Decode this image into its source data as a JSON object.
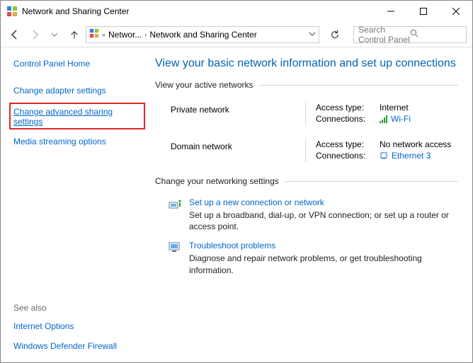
{
  "window": {
    "title": "Network and Sharing Center"
  },
  "breadcrumb": {
    "seg1": "Networ...",
    "seg2": "Network and Sharing Center"
  },
  "search": {
    "placeholder": "Search Control Panel"
  },
  "sidebar": {
    "home": "Control Panel Home",
    "adapter": "Change adapter settings",
    "adv_sharing": "Change advanced sharing settings",
    "media": "Media streaming options",
    "see_also": "See also",
    "internet_opts": "Internet Options",
    "firewall": "Windows Defender Firewall"
  },
  "main": {
    "heading": "View your basic network information and set up connections",
    "active_label": "View your active networks",
    "net1": {
      "name": "Private network",
      "access_label": "Access type:",
      "access_value": "Internet",
      "conn_label": "Connections:",
      "conn_value": "Wi-Fi"
    },
    "net2": {
      "name": "Domain network",
      "access_label": "Access type:",
      "access_value": "No network access",
      "conn_label": "Connections:",
      "conn_value": "Ethernet 3"
    },
    "change_label": "Change your networking settings",
    "task1": {
      "title": "Set up a new connection or network",
      "desc": "Set up a broadband, dial-up, or VPN connection; or set up a router or access point."
    },
    "task2": {
      "title": "Troubleshoot problems",
      "desc": "Diagnose and repair network problems, or get troubleshooting information."
    }
  }
}
